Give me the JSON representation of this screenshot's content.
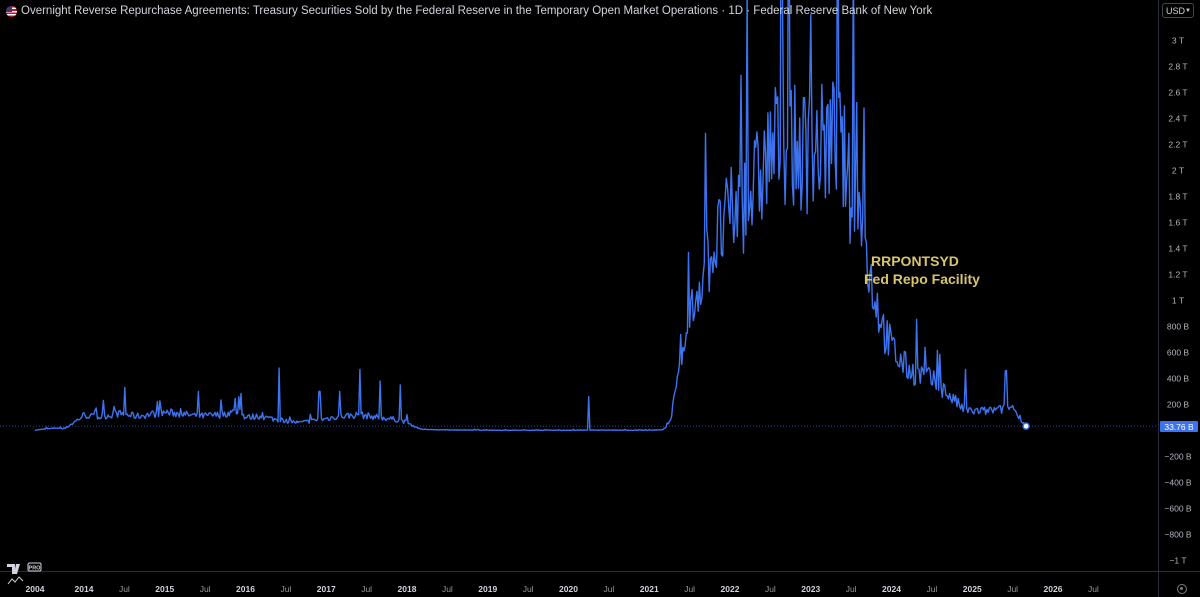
{
  "header": {
    "title": "Overnight Reverse Repurchase Agreements: Treasury Securities Sold by the Federal Reserve in the Temporary Open Market Operations · 1D · Federal Reserve Bank of New York"
  },
  "currency": {
    "label": "USD"
  },
  "annotation": {
    "line1": "RRPONTSYD",
    "line2": "Fed Repo Facility"
  },
  "last_value": {
    "label": "33.76 B",
    "value": 33.76
  },
  "logo": {
    "badge": "PRO"
  },
  "colors": {
    "line": "#3d73ef",
    "annotation": "#d8c56a",
    "background": "#000000",
    "axis_text": "#b2b5be"
  },
  "chart_data": {
    "type": "line",
    "unit": "billions USD",
    "ylim": [
      -1000,
      3000
    ],
    "y_ticks": [
      {
        "value": 3000,
        "label": "3 T"
      },
      {
        "value": 2800,
        "label": "2.8 T"
      },
      {
        "value": 2600,
        "label": "2.6 T"
      },
      {
        "value": 2400,
        "label": "2.4 T"
      },
      {
        "value": 2200,
        "label": "2.2 T"
      },
      {
        "value": 2000,
        "label": "2 T"
      },
      {
        "value": 1800,
        "label": "1.8 T"
      },
      {
        "value": 1600,
        "label": "1.6 T"
      },
      {
        "value": 1400,
        "label": "1.4 T"
      },
      {
        "value": 1200,
        "label": "1.2 T"
      },
      {
        "value": 1000,
        "label": "1 T"
      },
      {
        "value": 800,
        "label": "800 B"
      },
      {
        "value": 600,
        "label": "600 B"
      },
      {
        "value": 400,
        "label": "400 B"
      },
      {
        "value": 200,
        "label": "200 B"
      },
      {
        "value": -200,
        "label": "−200 B"
      },
      {
        "value": -400,
        "label": "−400 B"
      },
      {
        "value": -600,
        "label": "−600 B"
      },
      {
        "value": -800,
        "label": "−800 B"
      },
      {
        "value": -1000,
        "label": "−1 T"
      }
    ],
    "x_ticks": [
      {
        "date": "2004",
        "label": "2004",
        "major": true
      },
      {
        "date": "2014-01",
        "label": "2014",
        "major": true
      },
      {
        "date": "2014-07",
        "label": "Jul",
        "major": false
      },
      {
        "date": "2015-01",
        "label": "2015",
        "major": true
      },
      {
        "date": "2015-07",
        "label": "Jul",
        "major": false
      },
      {
        "date": "2016-01",
        "label": "2016",
        "major": true
      },
      {
        "date": "2016-07",
        "label": "Jul",
        "major": false
      },
      {
        "date": "2017-01",
        "label": "2017",
        "major": true
      },
      {
        "date": "2017-07",
        "label": "Jul",
        "major": false
      },
      {
        "date": "2018-01",
        "label": "2018",
        "major": true
      },
      {
        "date": "2018-07",
        "label": "Jul",
        "major": false
      },
      {
        "date": "2019-01",
        "label": "2019",
        "major": true
      },
      {
        "date": "2019-07",
        "label": "Jul",
        "major": false
      },
      {
        "date": "2020-01",
        "label": "2020",
        "major": true
      },
      {
        "date": "2020-07",
        "label": "Jul",
        "major": false
      },
      {
        "date": "2021-01",
        "label": "2021",
        "major": true
      },
      {
        "date": "2021-07",
        "label": "Jul",
        "major": false
      },
      {
        "date": "2022-01",
        "label": "2022",
        "major": true
      },
      {
        "date": "2022-07",
        "label": "Jul",
        "major": false
      },
      {
        "date": "2023-01",
        "label": "2023",
        "major": true
      },
      {
        "date": "2023-07",
        "label": "Jul",
        "major": false
      },
      {
        "date": "2024-01",
        "label": "2024",
        "major": true
      },
      {
        "date": "2024-07",
        "label": "Jul",
        "major": false
      },
      {
        "date": "2025-01",
        "label": "2025",
        "major": true
      },
      {
        "date": "2025-07",
        "label": "Jul",
        "major": false
      },
      {
        "date": "2026-01",
        "label": "2026",
        "major": true
      },
      {
        "date": "2026-07",
        "label": "Jul",
        "major": false
      }
    ],
    "series": [
      {
        "points": [
          [
            "2004",
            0
          ],
          [
            "2013-06",
            5
          ],
          [
            "2013-09",
            20
          ],
          [
            "2013-10",
            10
          ],
          [
            "2013-12",
            80
          ],
          [
            "2014-01",
            120
          ],
          [
            "2014-03",
            100
          ],
          [
            "2014-06",
            130
          ],
          [
            "2014-09",
            110
          ],
          [
            "2015-01",
            140
          ],
          [
            "2015-03",
            130
          ],
          [
            "2015-06",
            110
          ],
          [
            "2015-09",
            120
          ],
          [
            "2015-12",
            150
          ],
          [
            "2016-01",
            100
          ],
          [
            "2016-03",
            110
          ],
          [
            "2016-06",
            80
          ],
          [
            "2016-09",
            60
          ],
          [
            "2017-01",
            90
          ],
          [
            "2017-03",
            110
          ],
          [
            "2017-06",
            120
          ],
          [
            "2017-09",
            100
          ],
          [
            "2017-12",
            80
          ],
          [
            "2018-01",
            60
          ],
          [
            "2018-03",
            10
          ],
          [
            "2018-06",
            5
          ],
          [
            "2019-01",
            2
          ],
          [
            "2020-01",
            2
          ],
          [
            "2020-04",
            3
          ],
          [
            "2021-01",
            2
          ],
          [
            "2021-03",
            5
          ],
          [
            "2021-04",
            60
          ],
          [
            "2021-05",
            300
          ],
          [
            "2021-06",
            550
          ],
          [
            "2021-07",
            850
          ],
          [
            "2021-09",
            1250
          ],
          [
            "2021-11",
            1450
          ],
          [
            "2022-01",
            1650
          ],
          [
            "2022-03",
            1750
          ],
          [
            "2022-05",
            1900
          ],
          [
            "2022-07",
            2150
          ],
          [
            "2022-09",
            2250
          ],
          [
            "2022-11",
            2150
          ],
          [
            "2023-01",
            2150
          ],
          [
            "2023-03",
            2200
          ],
          [
            "2023-05",
            2250
          ],
          [
            "2023-06",
            2050
          ],
          [
            "2023-07",
            1800
          ],
          [
            "2023-08",
            1750
          ],
          [
            "2023-10",
            1150
          ],
          [
            "2023-12",
            750
          ],
          [
            "2024-02",
            550
          ],
          [
            "2024-04",
            450
          ],
          [
            "2024-06",
            420
          ],
          [
            "2024-08",
            350
          ],
          [
            "2024-10",
            250
          ],
          [
            "2024-12",
            150
          ],
          [
            "2025-03",
            150
          ],
          [
            "2025-05",
            160
          ],
          [
            "2025-07",
            180
          ],
          [
            "2025-09",
            33.76
          ]
        ],
        "spikes": [
          [
            "2014-07",
            330
          ],
          [
            "2015-06",
            300
          ],
          [
            "2015-12",
            260
          ],
          [
            "2016-06",
            480
          ],
          [
            "2016-12",
            300
          ],
          [
            "2017-03",
            300
          ],
          [
            "2017-06",
            470
          ],
          [
            "2017-09",
            380
          ],
          [
            "2017-12",
            350
          ],
          [
            "2020-04",
            260
          ],
          [
            "2022-12",
            2560
          ],
          [
            "2023-03",
            2350
          ],
          [
            "2024-06",
            640
          ],
          [
            "2024-12",
            470
          ],
          [
            "2025-06",
            460
          ]
        ]
      }
    ]
  }
}
